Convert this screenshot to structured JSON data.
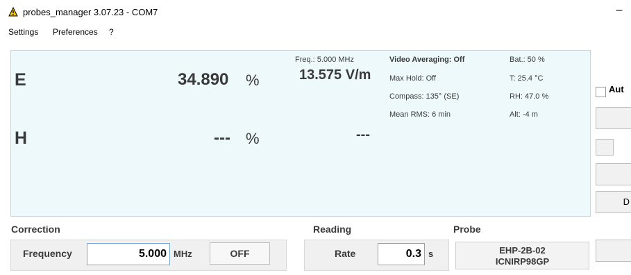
{
  "window": {
    "title": "probes_manager 3.07.23 - COM7",
    "minimize": "–"
  },
  "menu": [
    "Settings",
    "Preferences",
    "?"
  ],
  "display": {
    "e_label": "E",
    "e_value": "34.890",
    "e_unit": "%",
    "freq": "Freq.: 5.000 MHz",
    "vm_value": "13.575 V/m",
    "h_label": "H",
    "h_value": "---",
    "h_unit": "%",
    "h_field": "---",
    "info": [
      "Video Averaging: Off",
      "Max Hold: Off",
      "Compass: 135° (SE)",
      "Mean RMS: 6 min"
    ],
    "status": [
      "Bat.:  50 %",
      "T: 25.4 °C",
      "RH: 47.0 %",
      "Alt: -4 m"
    ]
  },
  "side": {
    "auto_label": "Aut",
    "d_label": "D"
  },
  "correction": {
    "title": "Correction",
    "frequency_label": "Frequency",
    "frequency_value": "5.000",
    "unit": "MHz",
    "off_label": "OFF"
  },
  "reading": {
    "title": "Reading",
    "rate_label": "Rate",
    "rate_value": "0.3",
    "rate_unit": "s"
  },
  "probe": {
    "title": "Probe",
    "model": "EHP-2B-02",
    "standard": "ICNIRP98GP"
  }
}
